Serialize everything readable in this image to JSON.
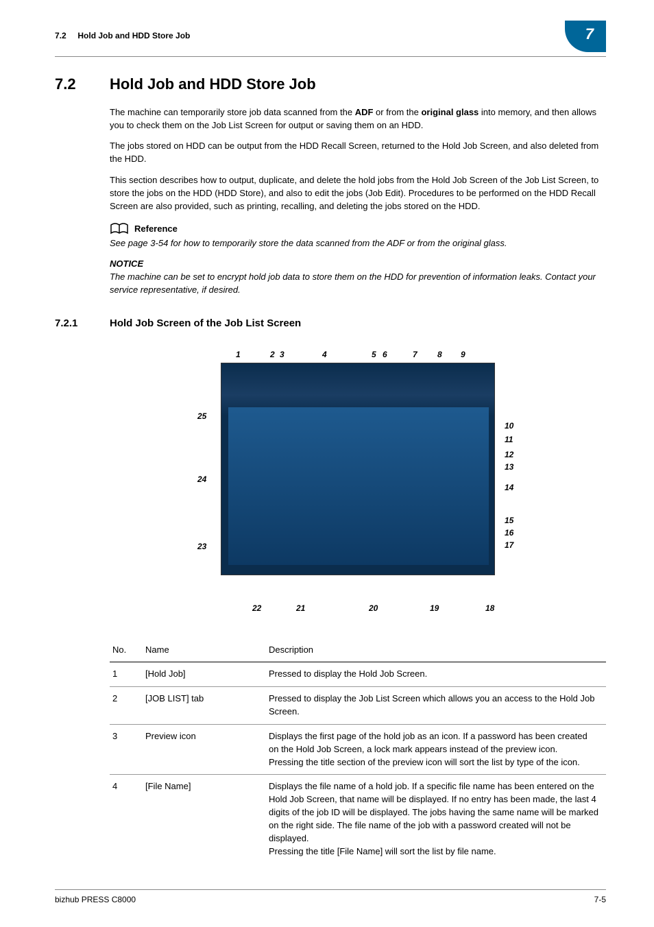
{
  "running_head": {
    "section_no": "7.2",
    "section_title": "Hold Job and HDD Store Job",
    "chapter_no": "7"
  },
  "section_7_2": {
    "number": "7.2",
    "title": "Hold Job and HDD Store Job",
    "p1_a": "The machine can temporarily store job data scanned from the ",
    "p1_bold1": "ADF",
    "p1_b": " or from the ",
    "p1_bold2": "original glass",
    "p1_c": " into memory, and then allows you to check them on the Job List Screen for output or saving them on an HDD.",
    "p2": "The jobs stored on HDD can be output from the HDD Recall Screen, returned to the Hold Job Screen, and also deleted from the HDD.",
    "p3": "This section describes how to output, duplicate, and delete the hold jobs from the Hold Job Screen of the Job List Screen, to store the jobs on the HDD (HDD Store), and also to edit the jobs (Job Edit). Procedures to be performed on the HDD Recall Screen are also provided, such as printing, recalling, and deleting the jobs stored on the HDD.",
    "reference_label": "Reference",
    "reference_text": "See page 3-54 for how to temporarily store the data scanned from the ADF or from the original glass.",
    "notice_label": "NOTICE",
    "notice_text": "The machine can be set to encrypt hold job data to store them on the HDD for prevention of information leaks. Contact your service representative, if desired."
  },
  "section_7_2_1": {
    "number": "7.2.1",
    "title": "Hold Job Screen of the Job List Screen"
  },
  "figure": {
    "callouts": {
      "c1": "1",
      "c2": "2",
      "c3": "3",
      "c4": "4",
      "c5": "5",
      "c6": "6",
      "c7": "7",
      "c8": "8",
      "c9": "9",
      "c10": "10",
      "c11": "11",
      "c12": "12",
      "c13": "13",
      "c14": "14",
      "c15": "15",
      "c16": "16",
      "c17": "17",
      "c18": "18",
      "c19": "19",
      "c20": "20",
      "c21": "21",
      "c22": "22",
      "c23": "23",
      "c24": "24",
      "c25": "25"
    }
  },
  "table": {
    "head": {
      "no": "No.",
      "name": "Name",
      "desc": "Description"
    },
    "rows": [
      {
        "no": "1",
        "name": "[Hold Job]",
        "desc": "Pressed to display the Hold Job Screen."
      },
      {
        "no": "2",
        "name": "[JOB LIST] tab",
        "desc": "Pressed to display the Job List Screen which allows you an access to the Hold Job Screen."
      },
      {
        "no": "3",
        "name": "Preview icon",
        "desc": "Displays the first page of the hold job as an icon. If a password has been created on the Hold Job Screen, a lock mark appears instead of the preview icon.\nPressing the title section of the preview icon will sort the list by type of the icon."
      },
      {
        "no": "4",
        "name": "[File Name]",
        "desc": "Displays the file name of a hold job. If a specific file name has been entered on the Hold Job Screen, that name will be displayed. If no entry has been made, the last 4 digits of the job ID will be displayed. The jobs having the same name will be marked on the right side. The file name of the job with a password created will not be displayed.\nPressing the title [File Name] will sort the list by file name."
      }
    ]
  },
  "footer": {
    "left": "bizhub PRESS C8000",
    "right": "7-5"
  }
}
